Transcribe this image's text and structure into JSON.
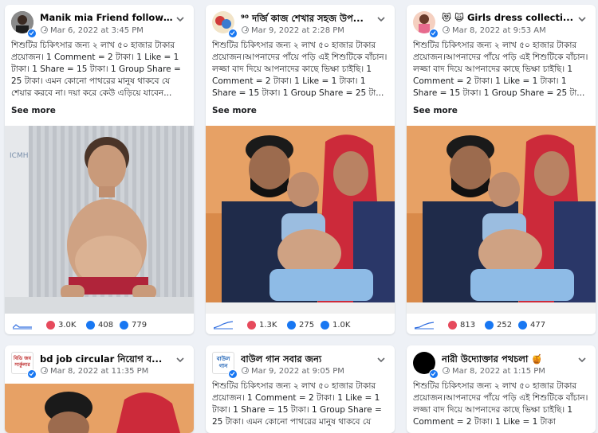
{
  "posts": [
    {
      "author": "Manik mia Friend followe...",
      "date": "Mar 6, 2022 at 3:45 PM",
      "text": "শিশুটির চিকিৎসার জন্য ২ লাখ ৫০ হাজার টাকার প্রয়োজন। 1 Comment = 2 টাকা। 1 Like = 1 টাকা। 1 Share = 15 টাকা। 1 Group Share = 25 টাকা। এমন কোনো পাথরের মানুষ থাকবে যে শেয়ার করবে না। দয়া করে কেউ এড়িয়ে যাবেন...",
      "see_more": "See more",
      "reactions": "3.0K",
      "comments": "408",
      "shares": "779"
    },
    {
      "author": "⁹⁰ দর্জি কাজ শেখার সহজ উপ...",
      "date": "Mar 9, 2022 at 2:28 PM",
      "text": "শিশুটির চিকিৎসার জন্য ২ লাখ ৫০ হাজার টাকার প্রয়োজন।আপনাদের পাঁয়ে পড়ি এই শিশুটিকে বাঁচান।লজ্জা বাদ দিয়ে আপনাদের কাছে ভিক্ষা চাইছি। 1 Comment = 2 টাকা। 1 Like = 1 টাকা। 1 Share = 15 টাকা। 1 Group Share = 25 টা...",
      "see_more": "See more",
      "reactions": "1.3K",
      "comments": "275",
      "shares": "1.0K"
    },
    {
      "author": "😻 🙀 Girls dress collecti...",
      "date": "Mar 8, 2022 at 9:53 AM",
      "text": "শিশুটির চিকিৎসার জন্য ২ লাখ ৫০ হাজার টাকার প্রয়োজন।আপনাদের পাঁয়ে পড়ি এই শিশুটিকে বাঁচান।লজ্জা বাদ দিয়ে আপনাদের কাছে ভিক্ষা চাইছি। 1 Comment = 2 টাকা। 1 Like = 1 টাকা। 1 Share = 15 টাকা। 1 Group Share = 25 টা...",
      "see_more": "See more",
      "reactions": "813",
      "comments": "252",
      "shares": "477"
    },
    {
      "author": "bd job circular নিয়োগ ব...",
      "date": "Mar 8, 2022 at 11:35 PM",
      "avatar_text": "বিডি জব সার্কুলার"
    },
    {
      "author": "বাউল গান সবার জন্য",
      "date": "Mar 9, 2022 at 9:05 PM",
      "avatar_text": "বাউল গান",
      "text": "শিশুটির চিকিৎসার জন্য ২ লাখ ৫০ হাজার টাকার প্রয়োজন। 1 Comment = 2 টাকা। 1 Like = 1 টাকা। 1 Share = 15 টাকা। 1 Group Share = 25 টাকা। এমন কোনো পাথরের মানুষ থাকবে যে"
    },
    {
      "author": "নারী উদ্যোক্তার পথচলা 🍯",
      "date": "Mar 8, 2022 at 1:15 PM",
      "text": "শিশুটির চিকিৎসার জন্য ২ লাখ ৫০ হাজার টাকার প্রয়োজন।আপনাদের পাঁয়ে পড়ি এই শিশুটিকে বাঁচান।লজ্জা বাদ দিয়ে আপনাদের কাছে ভিক্ষা চাইছি। 1 Comment = 2 টাকা। 1 Like = 1 টাকা"
    }
  ],
  "colors": {
    "accent": "#1877f2",
    "bg": "#eef1f6"
  }
}
